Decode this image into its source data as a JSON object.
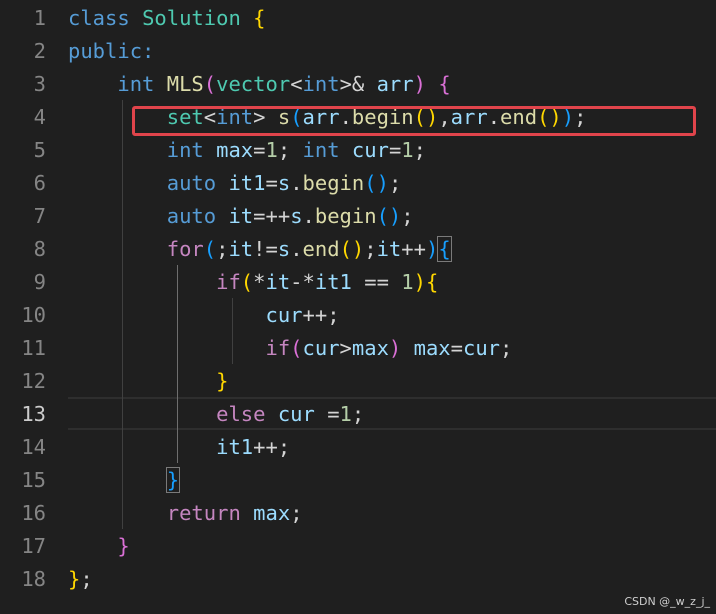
{
  "editor": {
    "line_numbers": [
      "1",
      "2",
      "3",
      "4",
      "5",
      "6",
      "7",
      "8",
      "9",
      "10",
      "11",
      "12",
      "13",
      "14",
      "15",
      "16",
      "17",
      "18"
    ],
    "active_line": "13",
    "highlighted_line": "4",
    "lines": [
      [
        {
          "t": "class",
          "c": "kw"
        },
        {
          "t": " "
        },
        {
          "t": "Solution",
          "c": "type"
        },
        {
          "t": " "
        },
        {
          "t": "{",
          "c": "b1"
        }
      ],
      [
        {
          "t": "public:",
          "c": "kw"
        }
      ],
      [
        {
          "t": "    "
        },
        {
          "t": "int",
          "c": "kw"
        },
        {
          "t": " "
        },
        {
          "t": "MLS",
          "c": "fn"
        },
        {
          "t": "(",
          "c": "b2"
        },
        {
          "t": "vector",
          "c": "type"
        },
        {
          "t": "<"
        },
        {
          "t": "int",
          "c": "kw"
        },
        {
          "t": ">& "
        },
        {
          "t": "arr",
          "c": "var"
        },
        {
          "t": ")",
          "c": "b2"
        },
        {
          "t": " "
        },
        {
          "t": "{",
          "c": "b2"
        }
      ],
      [
        {
          "t": "        "
        },
        {
          "t": "set",
          "c": "type"
        },
        {
          "t": "<"
        },
        {
          "t": "int",
          "c": "kw"
        },
        {
          "t": "> "
        },
        {
          "t": "s",
          "c": "fn"
        },
        {
          "t": "(",
          "c": "b3"
        },
        {
          "t": "arr",
          "c": "var"
        },
        {
          "t": "."
        },
        {
          "t": "begin",
          "c": "fn"
        },
        {
          "t": "()",
          "c": "b1"
        },
        {
          "t": ","
        },
        {
          "t": "arr",
          "c": "var"
        },
        {
          "t": "."
        },
        {
          "t": "end",
          "c": "fn"
        },
        {
          "t": "()",
          "c": "b1"
        },
        {
          "t": ")",
          "c": "b3"
        },
        {
          "t": ";"
        }
      ],
      [
        {
          "t": "        "
        },
        {
          "t": "int",
          "c": "kw"
        },
        {
          "t": " "
        },
        {
          "t": "max",
          "c": "var"
        },
        {
          "t": "="
        },
        {
          "t": "1",
          "c": "num"
        },
        {
          "t": "; "
        },
        {
          "t": "int",
          "c": "kw"
        },
        {
          "t": " "
        },
        {
          "t": "cur",
          "c": "var"
        },
        {
          "t": "="
        },
        {
          "t": "1",
          "c": "num"
        },
        {
          "t": ";"
        }
      ],
      [
        {
          "t": "        "
        },
        {
          "t": "auto",
          "c": "kw"
        },
        {
          "t": " "
        },
        {
          "t": "it1",
          "c": "var"
        },
        {
          "t": "="
        },
        {
          "t": "s",
          "c": "var"
        },
        {
          "t": "."
        },
        {
          "t": "begin",
          "c": "fn"
        },
        {
          "t": "()",
          "c": "b3"
        },
        {
          "t": ";"
        }
      ],
      [
        {
          "t": "        "
        },
        {
          "t": "auto",
          "c": "kw"
        },
        {
          "t": " "
        },
        {
          "t": "it",
          "c": "var"
        },
        {
          "t": "=++"
        },
        {
          "t": "s",
          "c": "var"
        },
        {
          "t": "."
        },
        {
          "t": "begin",
          "c": "fn"
        },
        {
          "t": "()",
          "c": "b3"
        },
        {
          "t": ";"
        }
      ],
      [
        {
          "t": "        "
        },
        {
          "t": "for",
          "c": "ctrl"
        },
        {
          "t": "(",
          "c": "b3"
        },
        {
          "t": ";"
        },
        {
          "t": "it",
          "c": "var"
        },
        {
          "t": "!="
        },
        {
          "t": "s",
          "c": "var"
        },
        {
          "t": "."
        },
        {
          "t": "end",
          "c": "fn"
        },
        {
          "t": "()",
          "c": "b1"
        },
        {
          "t": ";"
        },
        {
          "t": "it",
          "c": "var"
        },
        {
          "t": "++"
        },
        {
          "t": ")",
          "c": "b3"
        },
        {
          "t": "{",
          "c": "b3",
          "m": 1
        }
      ],
      [
        {
          "t": "            "
        },
        {
          "t": "if",
          "c": "ctrl"
        },
        {
          "t": "(",
          "c": "b1"
        },
        {
          "t": "*"
        },
        {
          "t": "it",
          "c": "var"
        },
        {
          "t": "-*"
        },
        {
          "t": "it1",
          "c": "var"
        },
        {
          "t": " == "
        },
        {
          "t": "1",
          "c": "num"
        },
        {
          "t": ")",
          "c": "b1"
        },
        {
          "t": "{",
          "c": "b1"
        }
      ],
      [
        {
          "t": "                "
        },
        {
          "t": "cur",
          "c": "var"
        },
        {
          "t": "++;"
        }
      ],
      [
        {
          "t": "                "
        },
        {
          "t": "if",
          "c": "ctrl"
        },
        {
          "t": "(",
          "c": "b2"
        },
        {
          "t": "cur",
          "c": "var"
        },
        {
          "t": ">"
        },
        {
          "t": "max",
          "c": "var"
        },
        {
          "t": ")",
          "c": "b2"
        },
        {
          "t": " "
        },
        {
          "t": "max",
          "c": "var"
        },
        {
          "t": "="
        },
        {
          "t": "cur",
          "c": "var"
        },
        {
          "t": ";"
        }
      ],
      [
        {
          "t": "            "
        },
        {
          "t": "}",
          "c": "b1"
        }
      ],
      [
        {
          "t": "            "
        },
        {
          "t": "else",
          "c": "ctrl"
        },
        {
          "t": " "
        },
        {
          "t": "cur",
          "c": "var"
        },
        {
          "t": " ="
        },
        {
          "t": "1",
          "c": "num"
        },
        {
          "t": ";"
        }
      ],
      [
        {
          "t": "            "
        },
        {
          "t": "it1",
          "c": "var"
        },
        {
          "t": "++;"
        }
      ],
      [
        {
          "t": "        "
        },
        {
          "t": "}",
          "c": "b3",
          "m": 1
        }
      ],
      [
        {
          "t": "        "
        },
        {
          "t": "return",
          "c": "ctrl"
        },
        {
          "t": " "
        },
        {
          "t": "max",
          "c": "var"
        },
        {
          "t": ";"
        }
      ],
      [
        {
          "t": "    "
        },
        {
          "t": "}",
          "c": "b2"
        }
      ],
      [
        {
          "t": "}",
          "c": "b1"
        },
        {
          "t": ";"
        }
      ]
    ]
  },
  "theme": {
    "background": "#1f1f1f",
    "highlight_box_color": "#e0444b"
  },
  "watermark": "CSDN @_w_z_j_"
}
